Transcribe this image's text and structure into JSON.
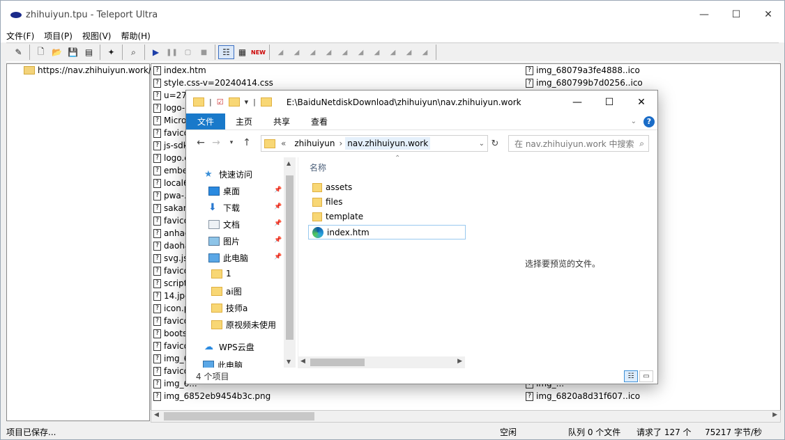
{
  "teleport": {
    "title": "zhihuiyun.tpu - Teleport Ultra",
    "menu": [
      "文件(F)",
      "项目(P)",
      "视图(V)",
      "帮助(H)"
    ],
    "tree_root": "https://nav.zhihuiyun.work/",
    "files_left": [
      "index.htm",
      "style.css-v=20240414.css",
      "u=2706000088,1047051916&fm=253&fmt=auto&app=138&f=JPEG.jpg-w=500&h=500",
      "logo-...",
      "Micro...",
      "favico...",
      "js-sdk...",
      "logo.c...",
      "embe...",
      "local6...",
      "pwa-...",
      "sakan...",
      "favico...",
      "anhao...",
      "daoha...",
      "svg.js...",
      "favico...",
      "script...",
      "14.jpg...",
      "icon.p...",
      "favico...",
      "boots...",
      "favico...",
      "img_6...",
      "favico...",
      "img_6...",
      "img_6852eb9454b3c.png"
    ],
    "files_right": [
      "img_68079a3fe4888..ico",
      "img_680799b7d0256..ico",
      "img_...",
      "",
      "",
      "",
      "",
      "",
      "",
      "",
      "",
      "",
      "",
      "",
      "",
      "",
      "",
      "",
      "",
      "",
      "",
      "",
      "",
      "",
      "",
      "img_...",
      "img_6820a8d31f607..ico"
    ],
    "status": {
      "left": "项目已保存...",
      "state": "空闲",
      "queue": "队列 0 个文件",
      "requested": "请求了 127 个",
      "rate": "75217 字节/秒"
    }
  },
  "explorer": {
    "path": "E:\\BaiduNetdiskDownload\\zhihuiyun\\nav.zhihuiyun.work",
    "ribbon": {
      "file": "文件",
      "home": "主页",
      "share": "共享",
      "view": "查看"
    },
    "address": {
      "prefix": "«",
      "seg1": "zhihuiyun",
      "sep": "›",
      "current": "nav.zhihuiyun.work"
    },
    "search_placeholder": "在 nav.zhihuiyun.work 中搜索",
    "nav_items": [
      {
        "label": "快速访问",
        "icon": "star-icon"
      },
      {
        "label": "桌面",
        "icon": "desktop-icon",
        "pinned": true
      },
      {
        "label": "下载",
        "icon": "download-icon",
        "pinned": true
      },
      {
        "label": "文档",
        "icon": "document-icon",
        "pinned": true
      },
      {
        "label": "图片",
        "icon": "picture-icon",
        "pinned": true
      },
      {
        "label": "此电脑",
        "icon": "computer-icon",
        "pinned": true
      },
      {
        "label": "1",
        "icon": "folder-icon"
      },
      {
        "label": "ai图",
        "icon": "folder-icon"
      },
      {
        "label": "技师a",
        "icon": "folder-icon"
      },
      {
        "label": "原视频未使用",
        "icon": "folder-icon"
      },
      {
        "label": "WPS云盘",
        "icon": "cloud-icon"
      },
      {
        "label": "此电脑",
        "icon": "computer-icon"
      }
    ],
    "column_header": "名称",
    "items": [
      {
        "name": "assets",
        "type": "folder"
      },
      {
        "name": "files",
        "type": "folder"
      },
      {
        "name": "template",
        "type": "folder"
      },
      {
        "name": "index.htm",
        "type": "edge"
      }
    ],
    "preview_text": "选择要预览的文件。",
    "item_count": "4 个项目"
  }
}
